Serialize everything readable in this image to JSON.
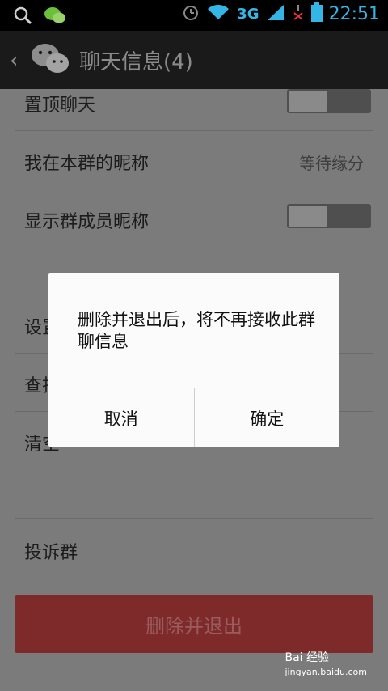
{
  "status_bar": {
    "network": "3G",
    "time": "22:51"
  },
  "action_bar": {
    "title": "聊天信息(4)"
  },
  "settings": {
    "pin_chat_label": "置顶聊天",
    "nickname_label": "我在本群的昵称",
    "nickname_value": "等待缘分",
    "show_nicknames_label": "显示群成员昵称",
    "set_label": "设置",
    "find_label": "查找",
    "clear_label": "清空",
    "report_label": "投诉群"
  },
  "delete_button": {
    "label": "删除并退出"
  },
  "dialog": {
    "message": "删除并退出后，将不再接收此群聊信息",
    "cancel_label": "取消",
    "confirm_label": "确定"
  },
  "watermark": {
    "brand": "Bai 经验",
    "url": "jingyan.baidu.com"
  }
}
